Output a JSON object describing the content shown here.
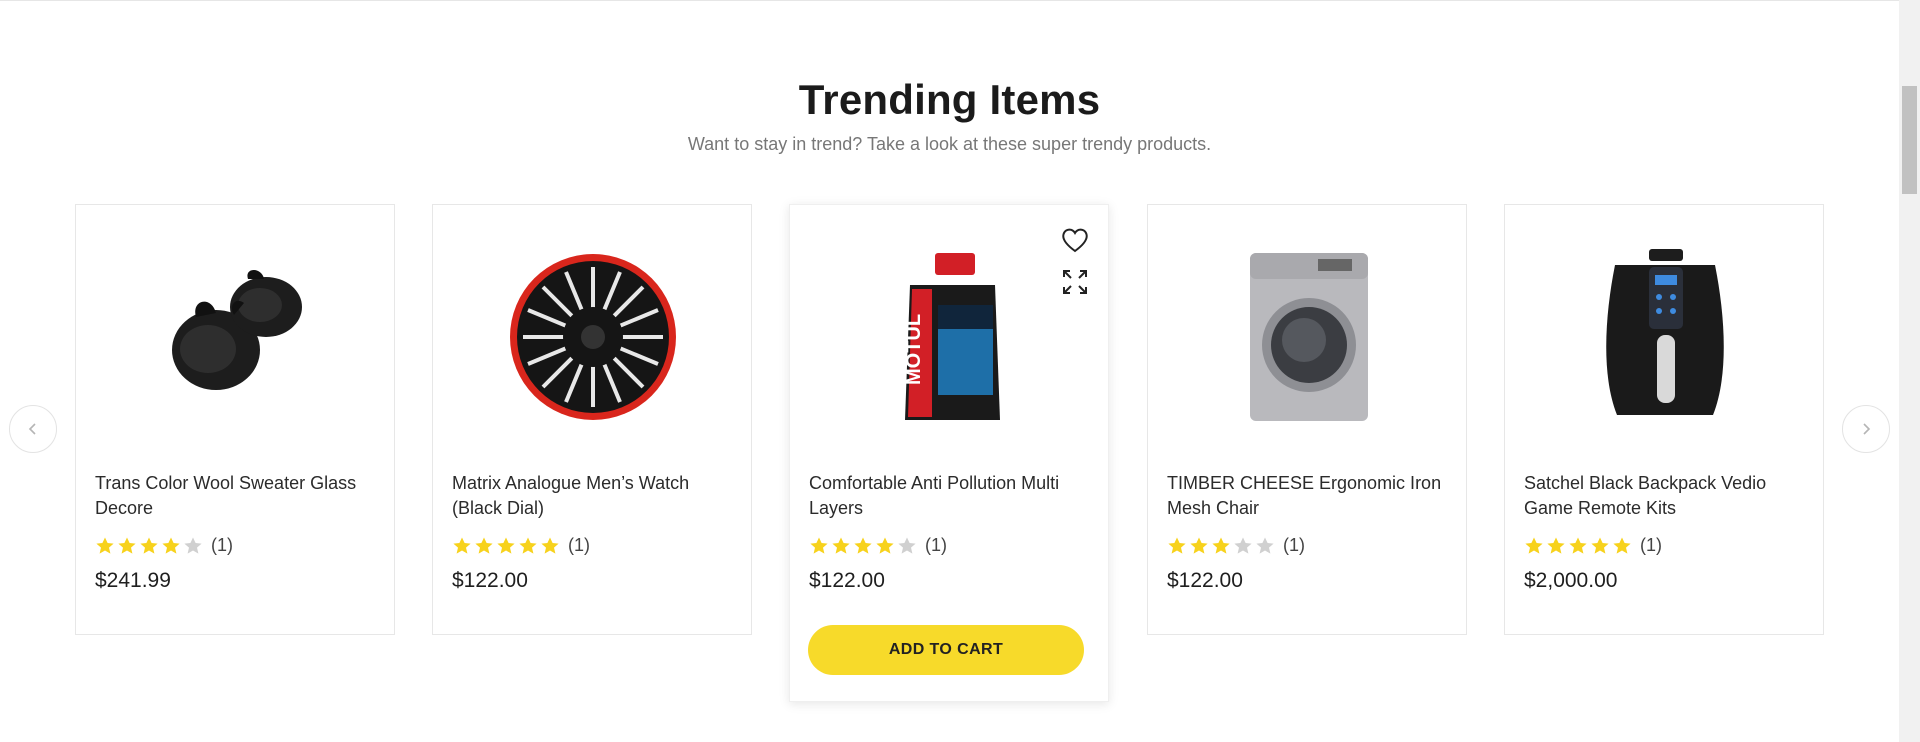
{
  "section": {
    "title": "Trending Items",
    "subtitle": "Want to stay in trend? Take a look at these super trendy products."
  },
  "colors": {
    "star_filled": "#f7d21c",
    "star_empty": "#d0d0d0",
    "cart_button": "#f7da2a",
    "heading": "#1b1b1b",
    "subtitle": "#777777"
  },
  "carousel": {
    "prev_icon": "chevron-left-icon",
    "next_icon": "chevron-right-icon",
    "products": [
      {
        "name": "Trans Color Wool Sweater Glass Decore",
        "rating": 4,
        "rating_max": 5,
        "review_count": "(1)",
        "price": "$241.99",
        "image_icon": "earbuds-icon"
      },
      {
        "name": "Matrix Analogue Men’s Watch (Black Dial)",
        "rating": 5,
        "rating_max": 5,
        "review_count": "(1)",
        "price": "$122.00",
        "image_icon": "wheel-cover-icon"
      },
      {
        "name": "Comfortable Anti Pollution Multi Layers",
        "rating": 4,
        "rating_max": 5,
        "review_count": "(1)",
        "price": "$122.00",
        "image_icon": "motor-oil-bottle-icon",
        "add_to_cart_label": "ADD TO CART"
      },
      {
        "name": "TIMBER CHEESE Ergonomic Iron Mesh Chair",
        "rating": 3,
        "rating_max": 5,
        "review_count": "(1)",
        "price": "$122.00",
        "image_icon": "washing-machine-icon"
      },
      {
        "name": "Satchel Black Backpack Vedio Game Remote Kits",
        "rating": 5,
        "rating_max": 5,
        "review_count": "(1)",
        "price": "$2,000.00",
        "image_icon": "air-fryer-icon"
      }
    ]
  }
}
